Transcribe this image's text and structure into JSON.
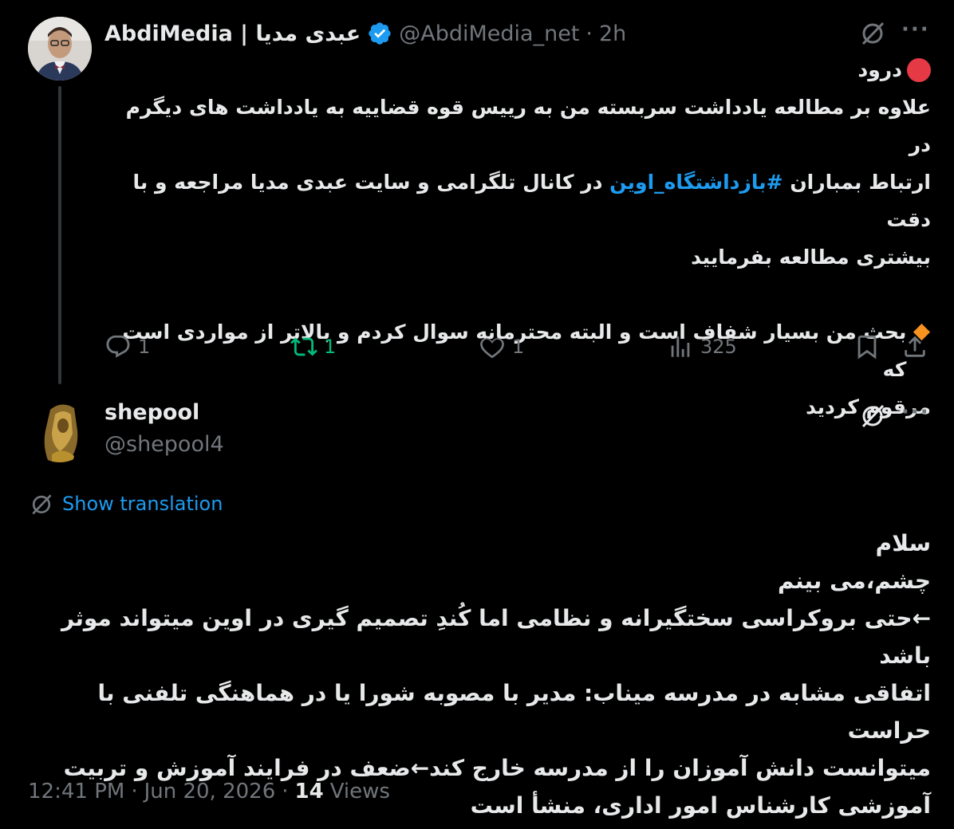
{
  "tweet1": {
    "name": "AbdiMedia | عبدی مدیا",
    "handle": "@AbdiMedia_net",
    "separator": "·",
    "time": "2h",
    "lines": {
      "line1": "درود",
      "line2": "علاوه بر مطالعه یادداشت سربسته من به رییس قوه قضاییه به یادداشت های دیگرم در",
      "line3_start": "ارتباط بمباران",
      "hashtag": "#بازداشتگاه_اوین",
      "line3_end": "در کانال تلگرامی و سایت عبدی مدیا مراجعه و با دقت",
      "line4": "بیشتری مطالعه بفرمایید",
      "line5": "بحث من بسیار شفاف است و البته محترمانه سوال کردم و بالاتر از مواردی است که",
      "line6": "مرقوم کردید"
    },
    "stats": {
      "replies": "1",
      "reposts": "1",
      "likes": "1",
      "views": "325"
    }
  },
  "tweet2": {
    "name": "shepool",
    "handle": "@shepool4",
    "show_translation": "Show translation",
    "lines": {
      "l1": "سلام",
      "l2": "چشم،می بینم",
      "l3": "←حتی بروکراسی سختگیرانه و نظامی اما کُندِ تصمیم گیری در اوین میتواند موثر باشد",
      "l4": "اتفاقی مشابه در مدرسه میناب: مدیر با مصوبه شورا یا در هماهنگی تلفنی با حراست",
      "l5": "میتوانست دانش آموزان را از مدرسه خارج کند←ضعف در فرایند آموزش و تربیت",
      "l6": "آموزشی کارشناس امور اداری، منشأ است"
    },
    "footer": {
      "time": "12:41 PM",
      "dot1": "·",
      "date": "Jun 20, 2026",
      "dot2": "·",
      "views_count": "14",
      "views_label": "Views"
    }
  },
  "icons": {
    "more": "···"
  },
  "colors": {
    "background": "#000000",
    "text": "#e7e9ea",
    "muted": "#71767b",
    "accent": "#1d9bf0",
    "repost_green": "#00ba7c"
  }
}
